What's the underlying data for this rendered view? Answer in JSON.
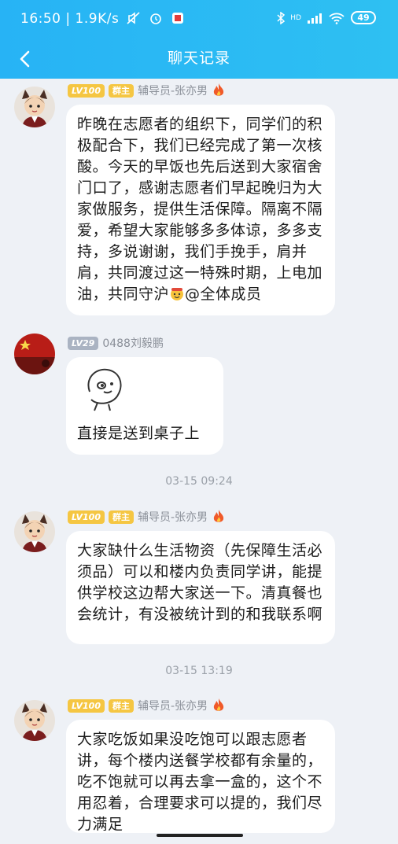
{
  "status_bar": {
    "time": "16:50",
    "speed": "1.9K/s",
    "network": "HD",
    "battery": "49"
  },
  "nav": {
    "title": "聊天记录"
  },
  "messages": [
    {
      "level": "LV100",
      "role": "群主",
      "sender": "辅导员-张亦男",
      "text": "昨晚在志愿者的组织下，同学们的积极配合下，我们已经完成了第一次核酸。今天的早饭也先后送到大家宿舍门口了，感谢志愿者们早起晚归为大家做服务，提供生活保障。隔离不隔爱，希望大家能够多多体谅，多多支持，多说谢谢，我们手挽手，肩并肩，共同渡过这一特殊时期，上电加油，共同守沪",
      "mention": "@全体成员"
    },
    {
      "level": "LV29",
      "sender": "0488刘毅鹏",
      "text": "直接是送到桌子上"
    },
    {
      "time": "03-15 09:24"
    },
    {
      "level": "LV100",
      "role": "群主",
      "sender": "辅导员-张亦男",
      "text": "大家缺什么生活物资（先保障生活必须品）可以和楼内负责同学讲，能提供学校这边帮大家送一下。清真餐也会统计，有没被统计到的和我联系啊"
    },
    {
      "time": "03-15 13:19"
    },
    {
      "level": "LV100",
      "role": "群主",
      "sender": "辅导员-张亦男",
      "text": "大家吃饭如果没吃饱可以跟志愿者讲，每个楼内送餐学校都有余量的，吃不饱就可以再去拿一盒的，这个不用忍着，合理要求可以提的，我们尽力满足"
    }
  ],
  "colors": {
    "header": "#2ab8f4",
    "background": "#eef1f6",
    "owner_badge": "#f5c642",
    "level_badge_grey": "#aab3c2"
  }
}
